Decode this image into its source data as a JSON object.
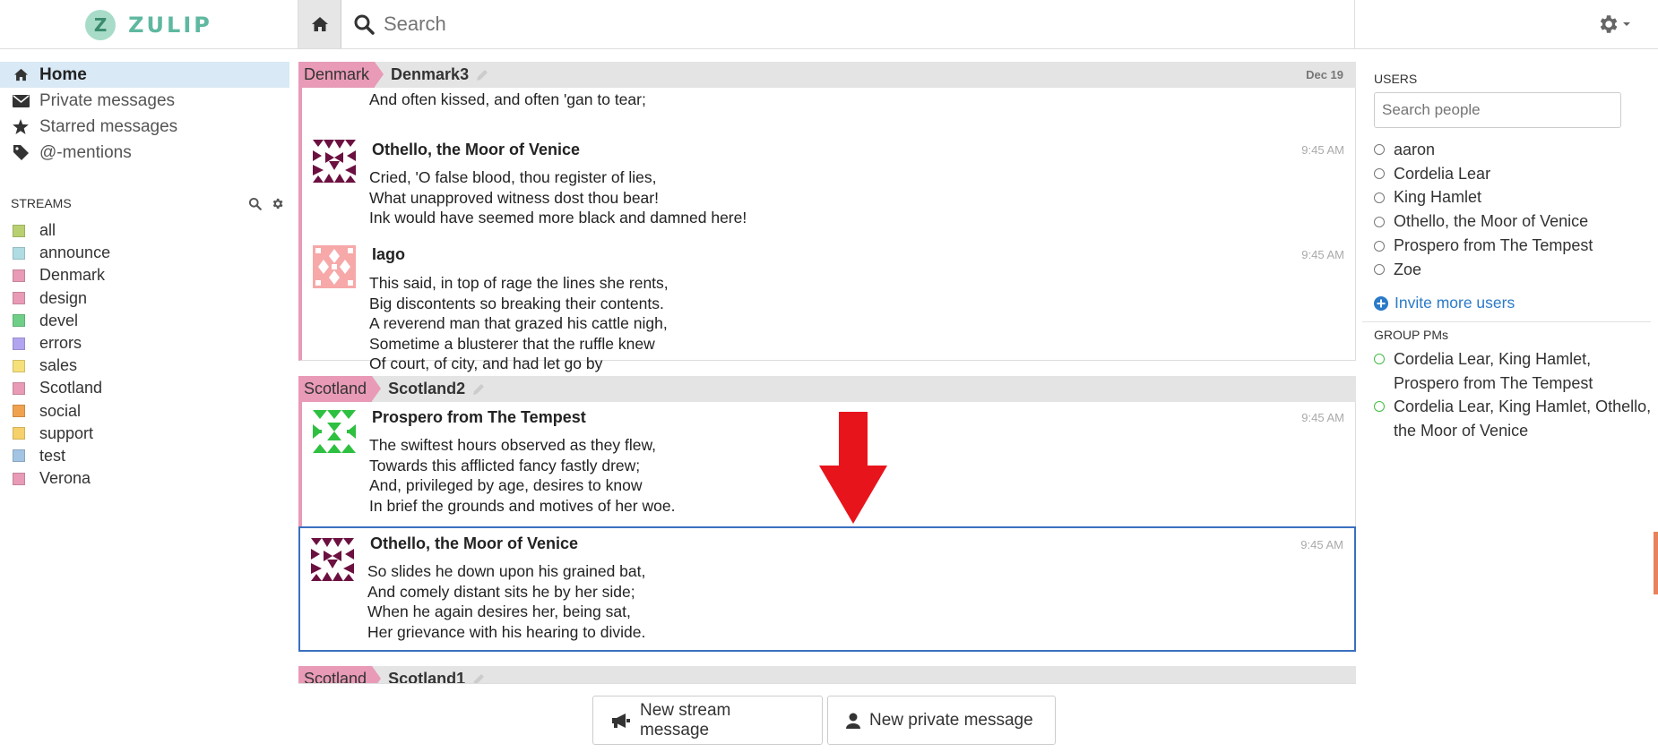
{
  "brand": {
    "logo_letter": "Z",
    "name": "ZULIP"
  },
  "search": {
    "placeholder": "Search"
  },
  "nav": {
    "home": "Home",
    "private_messages": "Private messages",
    "starred_messages": "Starred messages",
    "mentions": "@-mentions"
  },
  "streams": {
    "header": "STREAMS",
    "items": [
      {
        "name": "all",
        "color": "#b8d070"
      },
      {
        "name": "announce",
        "color": "#b0dde4"
      },
      {
        "name": "Denmark",
        "color": "#e89ab6"
      },
      {
        "name": "design",
        "color": "#e89ab6"
      },
      {
        "name": "devel",
        "color": "#6fcf88"
      },
      {
        "name": "errors",
        "color": "#b3a4f0"
      },
      {
        "name": "sales",
        "color": "#f6e07a"
      },
      {
        "name": "Scotland",
        "color": "#e89ab6"
      },
      {
        "name": "social",
        "color": "#f0a24e"
      },
      {
        "name": "support",
        "color": "#f6d06a"
      },
      {
        "name": "test",
        "color": "#a4c4e4"
      },
      {
        "name": "Verona",
        "color": "#e89ab6"
      }
    ]
  },
  "groups": {
    "denmark3": {
      "stream": "Denmark",
      "topic": "Denmark3",
      "date": "Dec 19",
      "first_line": "And often kissed, and often 'gan to tear;",
      "messages": [
        {
          "sender": "Othello, the Moor of Venice",
          "time": "9:45 AM",
          "lines": [
            "Cried, 'O false blood, thou register of lies,",
            "What unapproved witness dost thou bear!",
            "Ink would have seemed more black and damned here!"
          ]
        },
        {
          "sender": "Iago",
          "time": "9:45 AM",
          "lines": [
            "This said, in top of rage the lines she rents,",
            "Big discontents so breaking their contents.",
            "A reverend man that grazed his cattle nigh,",
            "Sometime a blusterer that the ruffle knew",
            "Of court, of city, and had let go by"
          ]
        }
      ]
    },
    "scotland2": {
      "stream": "Scotland",
      "topic": "Scotland2",
      "messages": [
        {
          "sender": "Prospero from The Tempest",
          "time": "9:45 AM",
          "lines": [
            "The swiftest hours observed as they flew,",
            "Towards this afflicted fancy fastly drew;",
            "And, privileged by age, desires to know",
            "In brief the grounds and motives of her woe."
          ]
        },
        {
          "sender": "Othello, the Moor of Venice",
          "time": "9:45 AM",
          "lines": [
            "So slides he down upon his grained bat,",
            "And comely distant sits he by her side;",
            "When he again desires her, being sat,",
            "Her grievance with his hearing to divide."
          ]
        }
      ]
    },
    "scotland1": {
      "stream": "Scotland",
      "topic": "Scotland1"
    }
  },
  "compose": {
    "stream_btn": "New stream message",
    "private_btn": "New private message"
  },
  "users": {
    "title": "USERS",
    "search_placeholder": "Search people",
    "list": [
      "aaron",
      "Cordelia Lear",
      "King Hamlet",
      "Othello, the Moor of Venice",
      "Prospero from The Tempest",
      "Zoe"
    ],
    "invite": "Invite more users"
  },
  "group_pms": {
    "title": "GROUP PMs",
    "list": [
      "Cordelia Lear, King Hamlet, Prospero from The Tempest",
      "Cordelia Lear, King Hamlet, Othello, the Moor of Venice"
    ]
  },
  "colors": {
    "denmark": "#e89ab6",
    "scotland": "#e89ab6",
    "selected_border": "#3a6fbf",
    "accent": "#5fb8a0",
    "arrow": "#e8141c"
  },
  "icons": [
    "home-icon",
    "search-icon",
    "gear-icon",
    "envelope-icon",
    "star-icon",
    "tag-icon",
    "pencil-icon",
    "megaphone-icon",
    "user-icon",
    "plus-circle-icon"
  ]
}
